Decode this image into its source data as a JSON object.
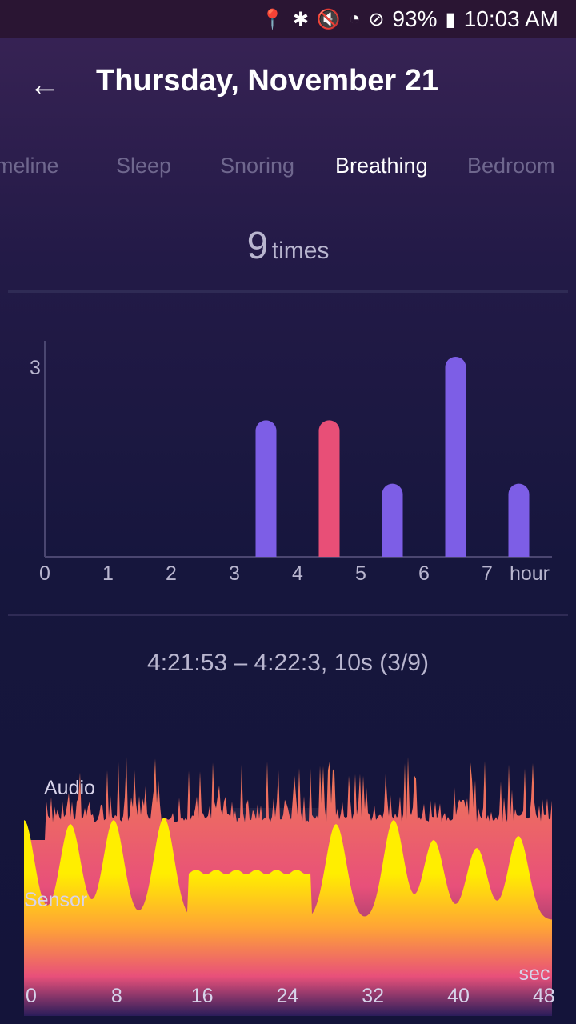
{
  "status_bar": {
    "icons": [
      "location-icon",
      "bluetooth-icon",
      "vibrate-mute-icon",
      "wifi-icon",
      "do-not-disturb-icon",
      "battery-icon"
    ],
    "battery": "93%",
    "time": "10:03 AM"
  },
  "header": {
    "back_icon": "arrow-left-icon",
    "title": "Thursday, November 21"
  },
  "tabs": [
    {
      "label": "meline"
    },
    {
      "label": "Sleep"
    },
    {
      "label": "Snoring"
    },
    {
      "label": "Breathing",
      "active": true
    },
    {
      "label": "Bedroom"
    }
  ],
  "summary": {
    "count": "9",
    "unit": "times"
  },
  "chart_data": [
    {
      "type": "bar",
      "x_ticks": [
        "0",
        "1",
        "2",
        "3",
        "4",
        "5",
        "6",
        "7"
      ],
      "x_unit": "hour",
      "y_ticks": [
        "3"
      ],
      "ylim": [
        0,
        3
      ],
      "bars": [
        {
          "hour": 3.5,
          "value": 2,
          "color": "#7d5ee6"
        },
        {
          "hour": 4.5,
          "value": 2,
          "color": "#e84f77"
        },
        {
          "hour": 5.5,
          "value": 1,
          "color": "#7d5ee6"
        },
        {
          "hour": 6.5,
          "value": 3,
          "color": "#7d5ee6"
        },
        {
          "hour": 7.5,
          "value": 1,
          "color": "#7d5ee6"
        }
      ]
    },
    {
      "type": "area",
      "series": [
        {
          "name": "Audio"
        },
        {
          "name": "Sensor"
        }
      ],
      "x_ticks": [
        "0",
        "8",
        "16",
        "24",
        "32",
        "40",
        "48"
      ],
      "x_unit": "sec"
    }
  ],
  "event": {
    "label": "4:21:53 – 4:22:3, 10s (3/9)"
  },
  "colors": {
    "purple_bar": "#7d5ee6",
    "red_bar": "#e84f77",
    "audio": "#e8507a",
    "sensor": "#ffe600"
  }
}
